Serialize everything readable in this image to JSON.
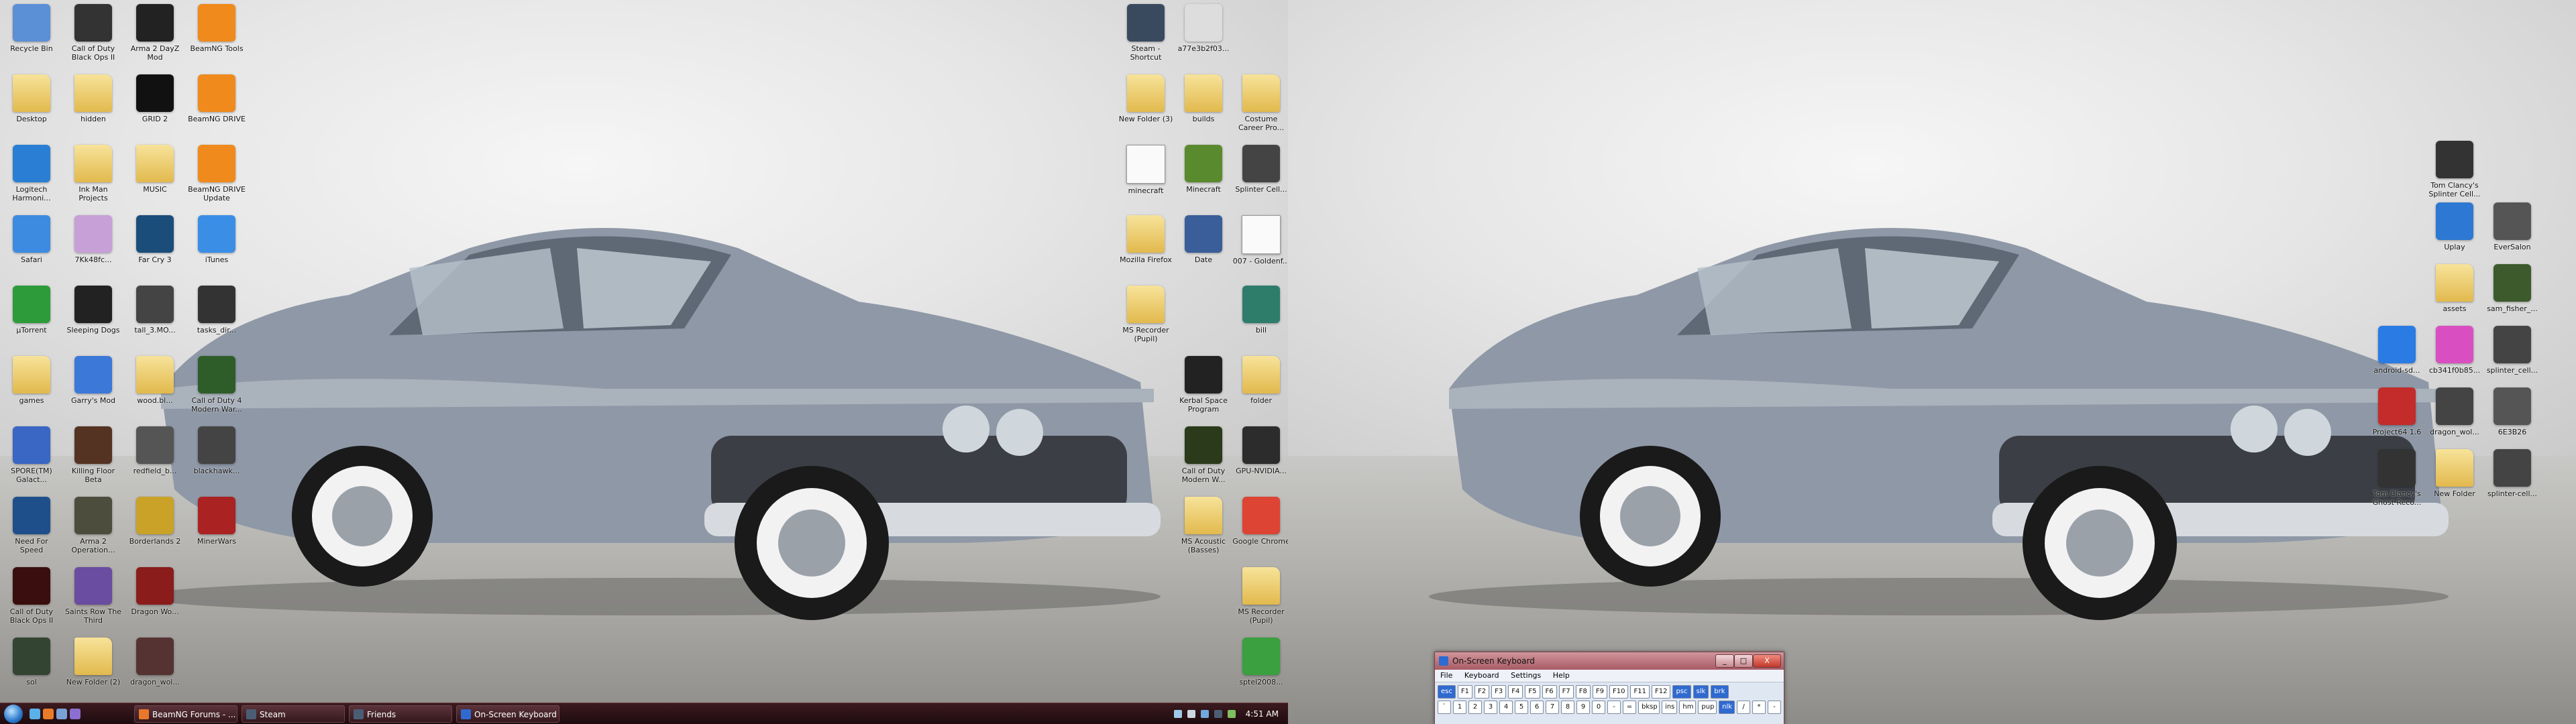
{
  "left_monitor": {
    "icons_left": [
      {
        "label": "Recycle Bin",
        "icon": "recycle-bin-icon",
        "color": "#5b8fd6",
        "col": 0,
        "row": 0
      },
      {
        "label": "Call of Duty Black Ops II",
        "icon": "cod-bo2-icon",
        "color": "#333333",
        "col": 1,
        "row": 0
      },
      {
        "label": "Arma 2 DayZ Mod",
        "icon": "dayz-icon",
        "color": "#222222",
        "col": 2,
        "row": 0
      },
      {
        "label": "BeamNG Tools",
        "icon": "beamng-icon",
        "color": "#f08a1c",
        "col": 3,
        "row": 0
      },
      {
        "label": "Desktop",
        "icon": "folder-icon",
        "color": "folder",
        "col": 0,
        "row": 1
      },
      {
        "label": "hidden",
        "icon": "folder-icon",
        "color": "folder",
        "col": 1,
        "row": 1
      },
      {
        "label": "GRID 2",
        "icon": "grid2-icon",
        "color": "#111111",
        "col": 2,
        "row": 1
      },
      {
        "label": "BeamNG DRIVE",
        "icon": "beamng-icon",
        "color": "#f08a1c",
        "col": 3,
        "row": 1
      },
      {
        "label": "Logitech Harmoni...",
        "icon": "logitech-icon",
        "color": "#2a7fd4",
        "col": 0,
        "row": 2
      },
      {
        "label": "Ink Man Projects",
        "icon": "folder-icon",
        "color": "folder",
        "col": 1,
        "row": 2
      },
      {
        "label": "MUSIC",
        "icon": "music-folder-icon",
        "color": "folder",
        "col": 2,
        "row": 2
      },
      {
        "label": "BeamNG DRIVE Update",
        "icon": "beamng-icon",
        "color": "#f08a1c",
        "col": 3,
        "row": 2
      },
      {
        "label": "Safari",
        "icon": "safari-icon",
        "color": "#3c8be0",
        "col": 0,
        "row": 3
      },
      {
        "label": "7Kk48fc...",
        "icon": "image-icon",
        "color": "#c7a0d8",
        "col": 1,
        "row": 3
      },
      {
        "label": "Far Cry 3",
        "icon": "farcry3-icon",
        "color": "#1b4d7a",
        "col": 2,
        "row": 3
      },
      {
        "label": "iTunes",
        "icon": "itunes-icon",
        "color": "#3a8ee6",
        "col": 3,
        "row": 3
      },
      {
        "label": "µTorrent",
        "icon": "utorrent-icon",
        "color": "#2e9b3a",
        "col": 0,
        "row": 4
      },
      {
        "label": "Sleeping Dogs",
        "icon": "sleeping-dogs-icon",
        "color": "#222222",
        "col": 1,
        "row": 4
      },
      {
        "label": "tall_3.MO...",
        "icon": "image-icon",
        "color": "#444444",
        "col": 2,
        "row": 4
      },
      {
        "label": "tasks_dir...",
        "icon": "image-icon",
        "color": "#333333",
        "col": 3,
        "row": 4
      },
      {
        "label": "games",
        "icon": "folder-icon",
        "color": "folder",
        "col": 0,
        "row": 5
      },
      {
        "label": "Garry's Mod",
        "icon": "gmod-icon",
        "color": "#3b78d8",
        "col": 1,
        "row": 5
      },
      {
        "label": "wood.bl...",
        "icon": "folder-icon",
        "color": "folder",
        "col": 2,
        "row": 5
      },
      {
        "label": "Call of Duty 4 Modern War...",
        "icon": "cod4-icon",
        "color": "#2f5d2a",
        "col": 3,
        "row": 5
      },
      {
        "label": "SPORE(TM) Galact...",
        "icon": "spore-icon",
        "color": "#3a66c4",
        "col": 0,
        "row": 6
      },
      {
        "label": "Killing Floor Beta",
        "icon": "killing-floor-icon",
        "color": "#553322",
        "col": 1,
        "row": 6
      },
      {
        "label": "redfield_b...",
        "icon": "image-icon",
        "color": "#555555",
        "col": 2,
        "row": 6
      },
      {
        "label": "blackhawk...",
        "icon": "image-icon",
        "color": "#444444",
        "col": 3,
        "row": 6
      },
      {
        "label": "Need For Speed",
        "icon": "nfs-icon",
        "color": "#1f4f8a",
        "col": 0,
        "row": 7
      },
      {
        "label": "Arma 2 Operation...",
        "icon": "arma2-icon",
        "color": "#4d4d3d",
        "col": 1,
        "row": 7
      },
      {
        "label": "Borderlands 2",
        "icon": "borderlands-icon",
        "color": "#c9a227",
        "col": 2,
        "row": 7
      },
      {
        "label": "MinerWars",
        "icon": "minerwars-icon",
        "color": "#aa2222",
        "col": 3,
        "row": 7
      },
      {
        "label": "Call of Duty Black Ops II",
        "icon": "cod-bo2-icon",
        "color": "#3a0e0e",
        "col": 0,
        "row": 8
      },
      {
        "label": "Saints Row The Third",
        "icon": "saints-row-icon",
        "color": "#6a4ca0",
        "col": 1,
        "row": 8
      },
      {
        "label": "Dragon Wo...",
        "icon": "image-icon",
        "color": "#8a1c1c",
        "col": 2,
        "row": 8
      },
      {
        "label": "sol",
        "icon": "app-icon",
        "color": "#334433",
        "col": 0,
        "row": 9
      },
      {
        "label": "New Folder (2)",
        "icon": "folder-icon",
        "color": "folder",
        "col": 1,
        "row": 9
      },
      {
        "label": "dragon_wol...",
        "icon": "image-icon",
        "color": "#553333",
        "col": 2,
        "row": 9
      }
    ],
    "icons_right": [
      {
        "label": "Steam - Shortcut",
        "icon": "steam-icon",
        "color": "#3a4a5e",
        "col": 0,
        "row": 0
      },
      {
        "label": "a77e3b2f03...",
        "icon": "image-icon",
        "color": "#dddddd",
        "col": 1,
        "row": 0
      },
      {
        "label": "New Folder (3)",
        "icon": "folder-icon",
        "color": "folder",
        "col": 0,
        "row": 1
      },
      {
        "label": "builds",
        "icon": "folder-icon",
        "color": "folder",
        "col": 1,
        "row": 1
      },
      {
        "label": "Costume Career Pro...",
        "icon": "folder-icon",
        "color": "folder",
        "col": 2,
        "row": 1
      },
      {
        "label": "minecraft",
        "icon": "file-icon",
        "color": "file",
        "col": 0,
        "row": 2
      },
      {
        "label": "Minecraft",
        "icon": "minecraft-icon",
        "color": "#5a8a2e",
        "col": 1,
        "row": 2
      },
      {
        "label": "Splinter Cell...",
        "icon": "image-icon",
        "color": "#444444",
        "col": 2,
        "row": 2
      },
      {
        "label": "Mozilla Firefox",
        "icon": "folder-icon",
        "color": "folder",
        "col": 0,
        "row": 3
      },
      {
        "label": "Date",
        "icon": "calendar-icon",
        "color": "#3a5e9a",
        "col": 1,
        "row": 3
      },
      {
        "label": "007 - Goldenf...",
        "icon": "file-icon",
        "color": "file",
        "col": 2,
        "row": 3
      },
      {
        "label": "MS Recorder (Pupil)",
        "icon": "folder-icon",
        "color": "folder",
        "col": 0,
        "row": 4
      },
      {
        "label": "bill",
        "icon": "app-icon",
        "color": "#2e7d6b",
        "col": 2,
        "row": 4
      },
      {
        "label": "Kerbal Space Program",
        "icon": "kerbal-icon",
        "color": "#222222",
        "col": 1,
        "row": 5
      },
      {
        "label": "folder",
        "icon": "folder-icon",
        "color": "folder",
        "col": 2,
        "row": 5
      },
      {
        "label": "Call of Duty Modern W...",
        "icon": "cod-mw-icon",
        "color": "#2a3a1a",
        "col": 1,
        "row": 6
      },
      {
        "label": "GPU-NVIDIA...",
        "icon": "nvidia-icon",
        "color": "#2c2c2c",
        "col": 2,
        "row": 6
      },
      {
        "label": "MS Acoustic (Basses)",
        "icon": "folder-icon",
        "color": "folder",
        "col": 1,
        "row": 7
      },
      {
        "label": "Google Chrome",
        "icon": "chrome-icon",
        "color": "#dd4433",
        "col": 2,
        "row": 7
      },
      {
        "label": "MS Recorder (Pupil)",
        "icon": "folder-icon",
        "color": "folder",
        "col": 2,
        "row": 8
      },
      {
        "label": "sptel2008...",
        "icon": "battery-icon",
        "color": "#3aa040",
        "col": 2,
        "row": 9
      }
    ],
    "taskbar": {
      "buttons": [
        {
          "label": "BeamNG Forums - ...",
          "icon": "firefox-icon",
          "color": "#e8772b"
        },
        {
          "label": "Steam",
          "icon": "steam-icon",
          "color": "#4b5d73"
        },
        {
          "label": "Friends",
          "icon": "steam-friends-icon",
          "color": "#4b5d73"
        },
        {
          "label": "On-Screen Keyboard",
          "icon": "keyboard-icon",
          "color": "#2f6ad0"
        }
      ],
      "clock": "4:51 AM"
    }
  },
  "right_monitor": {
    "icons": [
      {
        "label": "Tom Clancy's Splinter Cell...",
        "icon": "splinter-cell-icon",
        "color": "#333333",
        "col": 1,
        "row": 2
      },
      {
        "label": "Uplay",
        "icon": "uplay-icon",
        "color": "#2d78d2",
        "col": 1,
        "row": 3
      },
      {
        "label": "EverSalon",
        "icon": "image-icon",
        "color": "#555555",
        "col": 2,
        "row": 3
      },
      {
        "label": "assets",
        "icon": "folder-icon",
        "color": "folder",
        "col": 1,
        "row": 4
      },
      {
        "label": "sam_fisher_...",
        "icon": "image-icon",
        "color": "#3c5a2c",
        "col": 2,
        "row": 4
      },
      {
        "label": "android-sd...",
        "icon": "android-icon",
        "color": "#2a7be4",
        "col": 0,
        "row": 5
      },
      {
        "label": "cb341f0b85...",
        "icon": "image-icon",
        "color": "#d94fc1",
        "col": 1,
        "row": 5
      },
      {
        "label": "splinter_cell...",
        "icon": "image-icon",
        "color": "#444444",
        "col": 2,
        "row": 5
      },
      {
        "label": "Project64 1.6",
        "icon": "project64-icon",
        "color": "#c42b2b",
        "col": 0,
        "row": 6
      },
      {
        "label": "dragon_wol...",
        "icon": "image-icon",
        "color": "#444444",
        "col": 1,
        "row": 6
      },
      {
        "label": "6E3B26",
        "icon": "image-icon",
        "color": "#555555",
        "col": 2,
        "row": 6
      },
      {
        "label": "Tom Clancy's Ghost Reco...",
        "icon": "ghost-recon-icon",
        "color": "#333333",
        "col": 0,
        "row": 7
      },
      {
        "label": "New Folder",
        "icon": "folder-icon",
        "color": "folder",
        "col": 1,
        "row": 7
      },
      {
        "label": "splinter-cell...",
        "icon": "image-icon",
        "color": "#444444",
        "col": 2,
        "row": 7
      }
    ],
    "osk": {
      "title": "On-Screen Keyboard",
      "menu": [
        "File",
        "Keyboard",
        "Settings",
        "Help"
      ],
      "close": "X",
      "row1": [
        "esc",
        "F1",
        "F2",
        "F3",
        "F4",
        "F5",
        "F6",
        "F7",
        "F8",
        "F9",
        "F10",
        "F11",
        "F12",
        "psc",
        "slk",
        "brk"
      ],
      "row2": [
        "`",
        "1",
        "2",
        "3",
        "4",
        "5",
        "6",
        "7",
        "8",
        "9",
        "0",
        "-",
        "=",
        "bksp",
        "ins",
        "hm",
        "pup",
        "nlk",
        "/",
        "*",
        "-"
      ]
    }
  }
}
